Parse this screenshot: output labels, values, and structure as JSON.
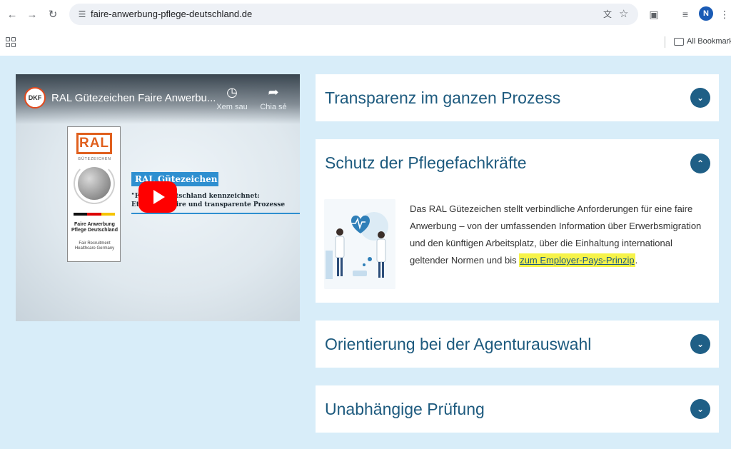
{
  "browser": {
    "url": "faire-anwerbung-pflege-deutschland.de",
    "avatar_initial": "N",
    "bookmarks_label": "All Bookmarks"
  },
  "video": {
    "channel_logo": "DKF",
    "title": "RAL Gütezeichen Faire Anwerbu...",
    "watch_later": "Xem sau",
    "share": "Chia sẻ",
    "ral_logo": "RAL",
    "ral_sub": "GÜTEZEICHEN",
    "ral_text1": "Faire Anwerbung Pflege Deutschland",
    "ral_text2": "Fair Recruitment Healthcare Germany",
    "slide_heading": "RAL Gütezeichen",
    "slide_line1": "\"Fa           ung Deutschland kennzeichnet:",
    "slide_line2": "Et                 ethare, faire und transparente Prozesse"
  },
  "accordion": {
    "items": [
      {
        "title": "Transparenz im ganzen Prozess",
        "expanded": false
      },
      {
        "title": "Schutz der Pflegefachkräfte",
        "expanded": true
      },
      {
        "title": "Orientierung bei der Agenturauswahl",
        "expanded": false
      },
      {
        "title": "Unabhängige Prüfung",
        "expanded": false
      }
    ],
    "expanded_text": "Das RAL Gütezeichen stellt verbindliche Anforderungen für eine faire Anwerbung – von der umfassenden Information über Erwerbsmigration und den künftigen Arbeitsplatz, über die Einhaltung international geltender Normen und bis ",
    "expanded_link": "zum Employer-Pays-Prinzip",
    "expanded_tail": "."
  },
  "colors": {
    "page_bg": "#d8edf9",
    "accent": "#1f5f86",
    "title": "#1d5a7e",
    "highlight": "#f6f34a",
    "youtube_red": "#ff0000"
  }
}
